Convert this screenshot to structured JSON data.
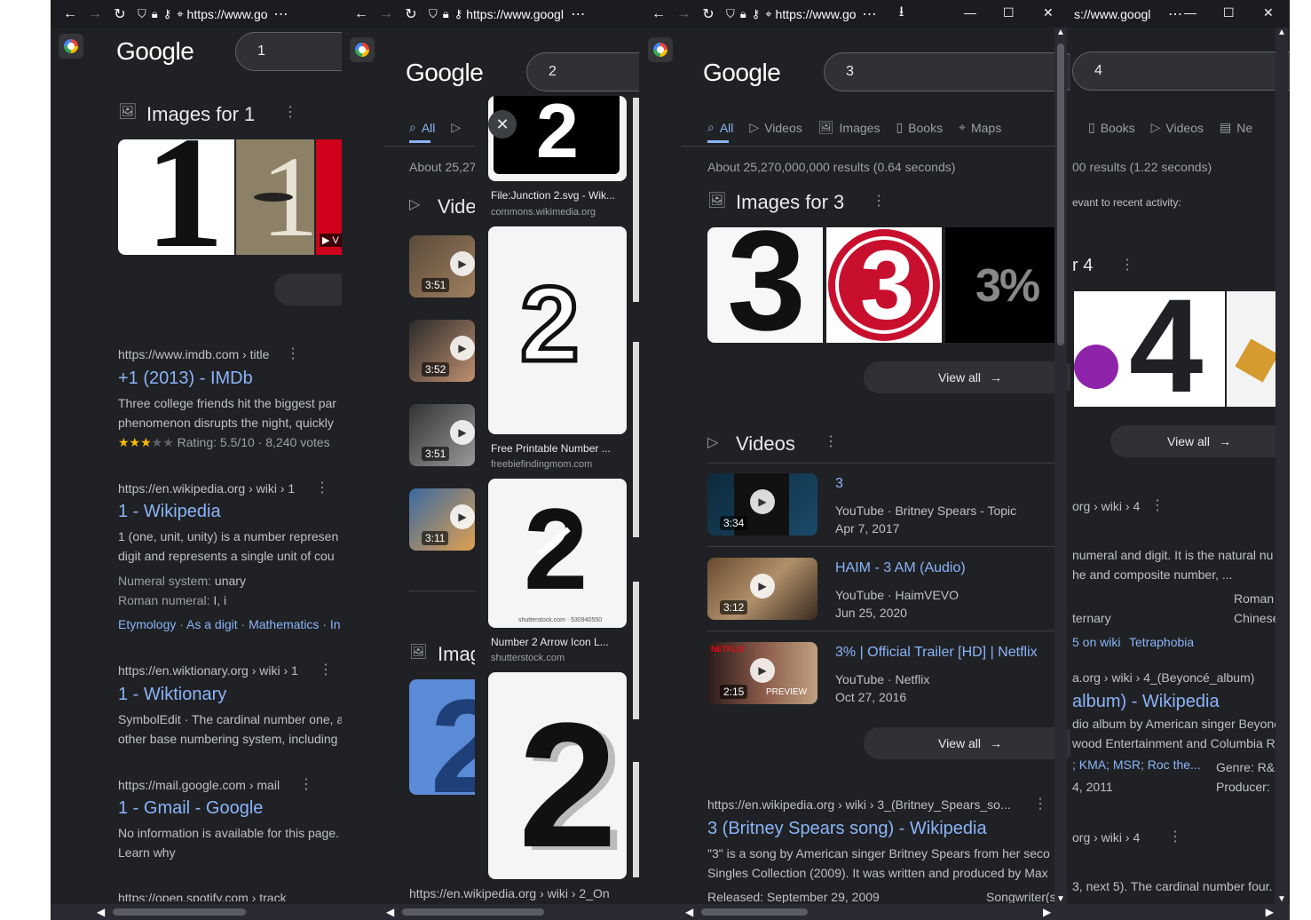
{
  "w1": {
    "url": "https://www.go",
    "search": "1",
    "images_header": "Images for 1",
    "results": [
      {
        "cite": "https://www.imdb.com › title",
        "title": "+1 (2013) - IMDb",
        "s1": "Three college friends hit the biggest par",
        "s2": "phenomenon disrupts the night, quickly",
        "rating": "Rating: 5.5/10 · 8,240 votes"
      },
      {
        "cite": "https://en.wikipedia.org › wiki › 1",
        "title": "1 - Wikipedia",
        "s1": "1 (one, unit, unity) is a number represen",
        "s2": "digit and represents a single unit of cou",
        "f1k": "Numeral system:",
        "f1v": "unary",
        "f2k": "Roman numeral:",
        "f2v": "I, i",
        "links": [
          "Etymology",
          "As a digit",
          "Mathematics",
          "In"
        ]
      },
      {
        "cite": "https://en.wiktionary.org › wiki › 1",
        "title": "1 - Wiktionary",
        "s1": "SymbolEdit · The cardinal number one, a",
        "s2": "other base numbering system, including"
      },
      {
        "cite": "https://mail.google.com › mail",
        "title": "1 - Gmail - Google",
        "s1": "No information is available for this page.",
        "s2": "Learn why"
      },
      {
        "cite": "https://open.spotify.com › track"
      }
    ]
  },
  "w2": {
    "url": "https://www.googl",
    "search": "2",
    "tab_all": "All",
    "about": "About 25,27",
    "videos_header": "Vide",
    "images_header": "Imag",
    "durations": [
      "3:51",
      "3:52",
      "3:51",
      "3:11"
    ],
    "bottom_cite": "https://en.wikipedia.org › wiki › 2_On",
    "cards": [
      {
        "title": "File:Junction 2.svg - Wik...",
        "source": "commons.wikimedia.org"
      },
      {
        "title": "Free Printable Number ...",
        "source": "freebiefindingmom.com"
      },
      {
        "title": "Number 2 Arrow Icon L...",
        "source": "shutterstock.com",
        "watermark": "shutterstock.com · 530940550"
      },
      {
        "title": "",
        "source": ""
      }
    ]
  },
  "w3": {
    "url": "https://www.go",
    "search": "3",
    "tabs": [
      "All",
      "Videos",
      "Images",
      "Books",
      "Maps"
    ],
    "about": "About 25,270,000,000 results (0.64 seconds)",
    "images_header": "Images for 3",
    "view_all": "View all",
    "videos_header": "Videos",
    "videos": [
      {
        "title": "3",
        "source": "YouTube · Britney Spears - Topic",
        "date": "Apr 7, 2017",
        "duration": "3:34"
      },
      {
        "title": "HAIM - 3 AM (Audio)",
        "source": "YouTube · HaimVEVO",
        "date": "Jun 25, 2020",
        "duration": "3:12"
      },
      {
        "title": "3% | Official Trailer [HD] | Netflix",
        "source": "YouTube · Netflix",
        "date": "Oct 27, 2016",
        "duration": "2:15",
        "badge": "NETFLIX",
        "overlay": "PREVIEW"
      }
    ],
    "result": {
      "cite": "https://en.wikipedia.org › wiki › 3_(Britney_Spears_so...",
      "title": "3 (Britney Spears song) - Wikipedia",
      "s1": "\"3\" is a song by American singer Britney Spears from her seco",
      "s2": "Singles Collection (2009). It was written and produced by Max",
      "s3": "Released: September 29, 2009",
      "s3b": "Songwriter(s"
    }
  },
  "w4": {
    "url": "s://www.googl",
    "search": "4",
    "tabs": [
      "Books",
      "Videos",
      "Ne"
    ],
    "about": "00 results (1.22 seconds)",
    "recent": "evant to recent activity:",
    "images_header": "r 4",
    "view_all": "View all",
    "r1": {
      "cite": "org › wiki › 4",
      "s1": "numeral and digit. It is the natural nu",
      "s2": "he and composite number, ...",
      "k1": "Roman",
      "k2": "Chinese",
      "v2": "ternary",
      "links": [
        "5 on wiki",
        "Tetraphobia"
      ]
    },
    "r2": {
      "cite": "a.org › wiki › 4_(Beyoncé_album)",
      "title": "album) - Wikipedia",
      "s1": "dio album by American singer Beyonc",
      "s2": "wood Entertainment and Columbia Re",
      "labels": "; KMA; MSR; Roc the...",
      "genre": "Genre: R&",
      "date": "4, 2011",
      "producer": "Producer:"
    },
    "r3": {
      "cite": "org › wiki › 4",
      "s1": "3, next 5). The cardinal number four."
    }
  }
}
